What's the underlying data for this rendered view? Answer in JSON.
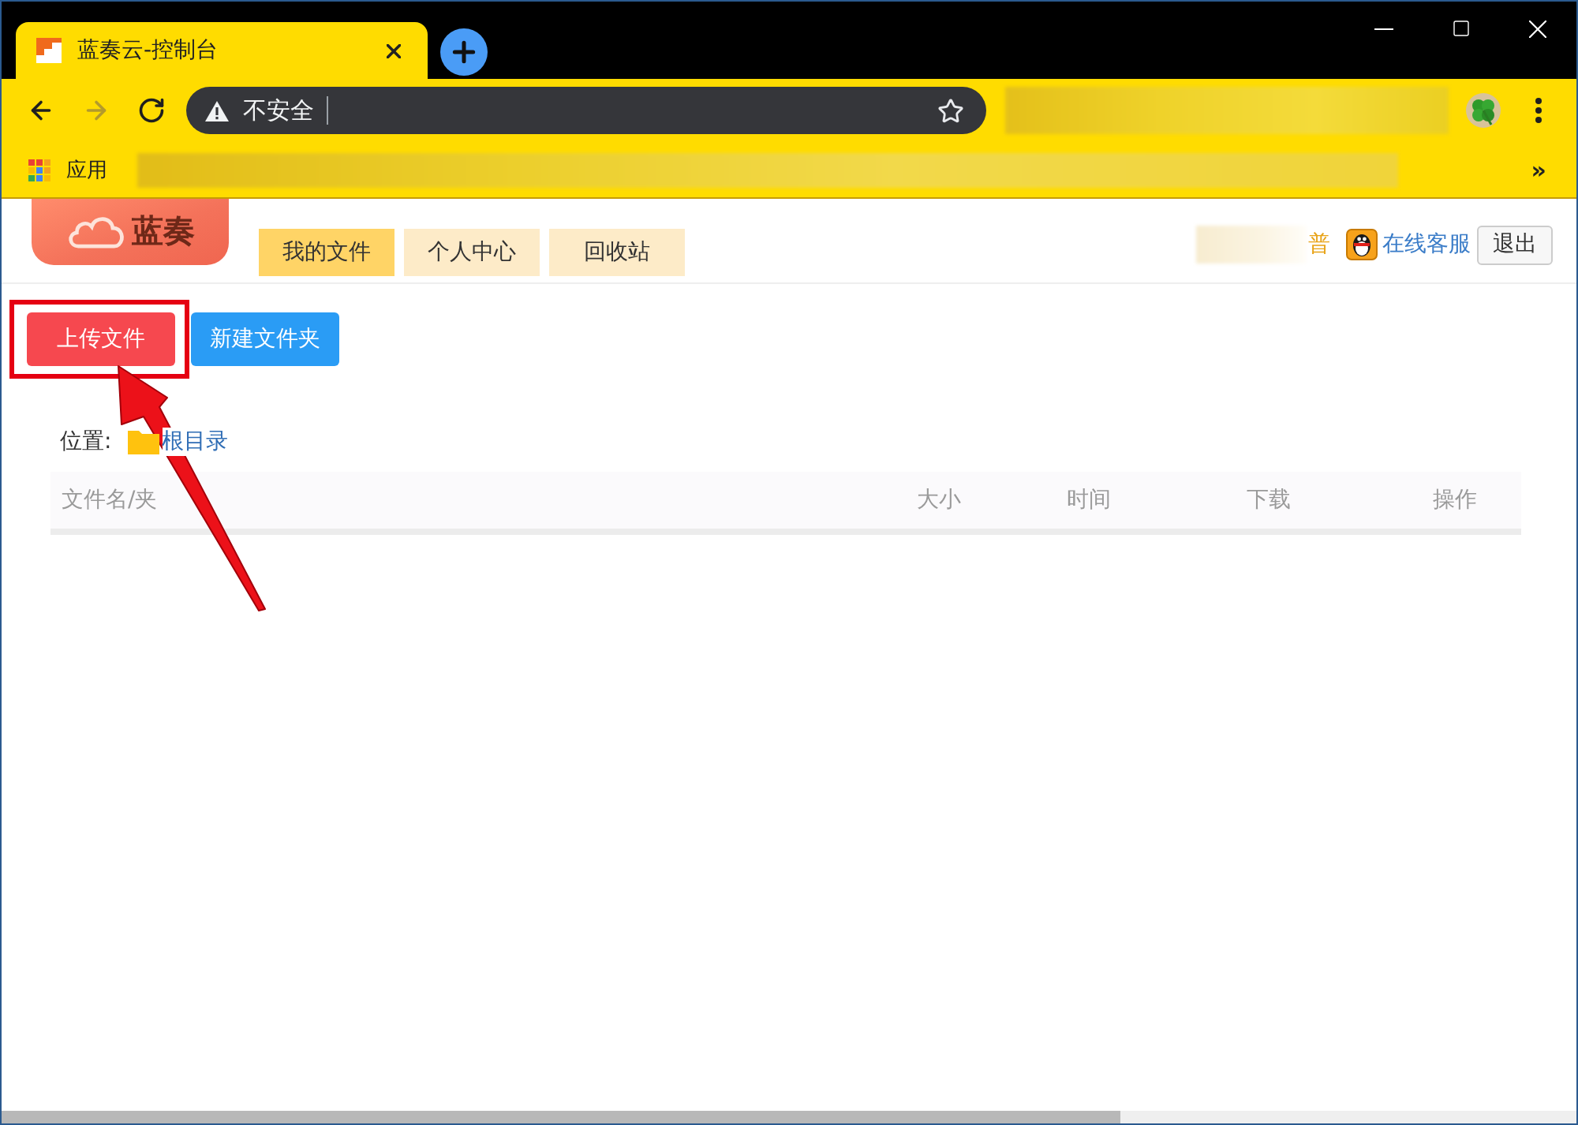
{
  "browser": {
    "tab": {
      "title": "蓝奏云-控制台"
    },
    "nav_buttons": [
      {
        "kind": "back",
        "disabled": false
      },
      {
        "kind": "forward",
        "disabled": true
      },
      {
        "kind": "reload",
        "disabled": false
      }
    ],
    "address_bar": {
      "security_label": "不安全"
    },
    "bookmarks_bar": {
      "items": [
        {
          "label": "应用"
        }
      ],
      "overflow": "»"
    }
  },
  "page": {
    "logo": {
      "text": "蓝奏"
    },
    "nav_tabs": [
      {
        "label": "我的文件",
        "selected": true
      },
      {
        "label": "个人中心",
        "selected": false
      },
      {
        "label": "回收站",
        "selected": false
      }
    ],
    "user_label": "普",
    "support_link": "在线客服",
    "logout_button": "退出",
    "actions": [
      {
        "kind": "upload",
        "label": "上传文件",
        "highlighted": true
      },
      {
        "kind": "new_folder",
        "label": "新建文件夹",
        "highlighted": false
      }
    ],
    "location": {
      "label": "位置:",
      "path": "根目录"
    },
    "table": {
      "columns": [
        "文件名/夹",
        "大小",
        "时间",
        "下载",
        "操作"
      ]
    }
  }
}
